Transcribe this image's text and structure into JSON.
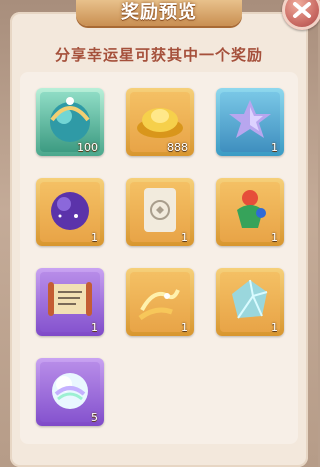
{
  "dialog": {
    "title": "奖励预览",
    "subtitle": "分享幸运星可获其中一个奖励"
  },
  "rewards": [
    {
      "name": "crystal-orb",
      "quantity": "100",
      "frame": "green"
    },
    {
      "name": "gold-ingot",
      "quantity": "888",
      "frame": "gold"
    },
    {
      "name": "lucky-star",
      "quantity": "1",
      "frame": "blue"
    },
    {
      "name": "purple-orb",
      "quantity": "1",
      "frame": "gold"
    },
    {
      "name": "scroll-card",
      "quantity": "1",
      "frame": "gold"
    },
    {
      "name": "costume-figure",
      "quantity": "1",
      "frame": "gold"
    },
    {
      "name": "map-scroll",
      "quantity": "1",
      "frame": "purple"
    },
    {
      "name": "golden-wind",
      "quantity": "1",
      "frame": "gold"
    },
    {
      "name": "ice-crystal",
      "quantity": "1",
      "frame": "gold"
    },
    {
      "name": "rainbow-orb",
      "quantity": "5",
      "frame": "purple"
    }
  ],
  "colors": {
    "title": "#ffffff",
    "subtitle": "#a5503b",
    "panel": "#f3e8dc"
  }
}
